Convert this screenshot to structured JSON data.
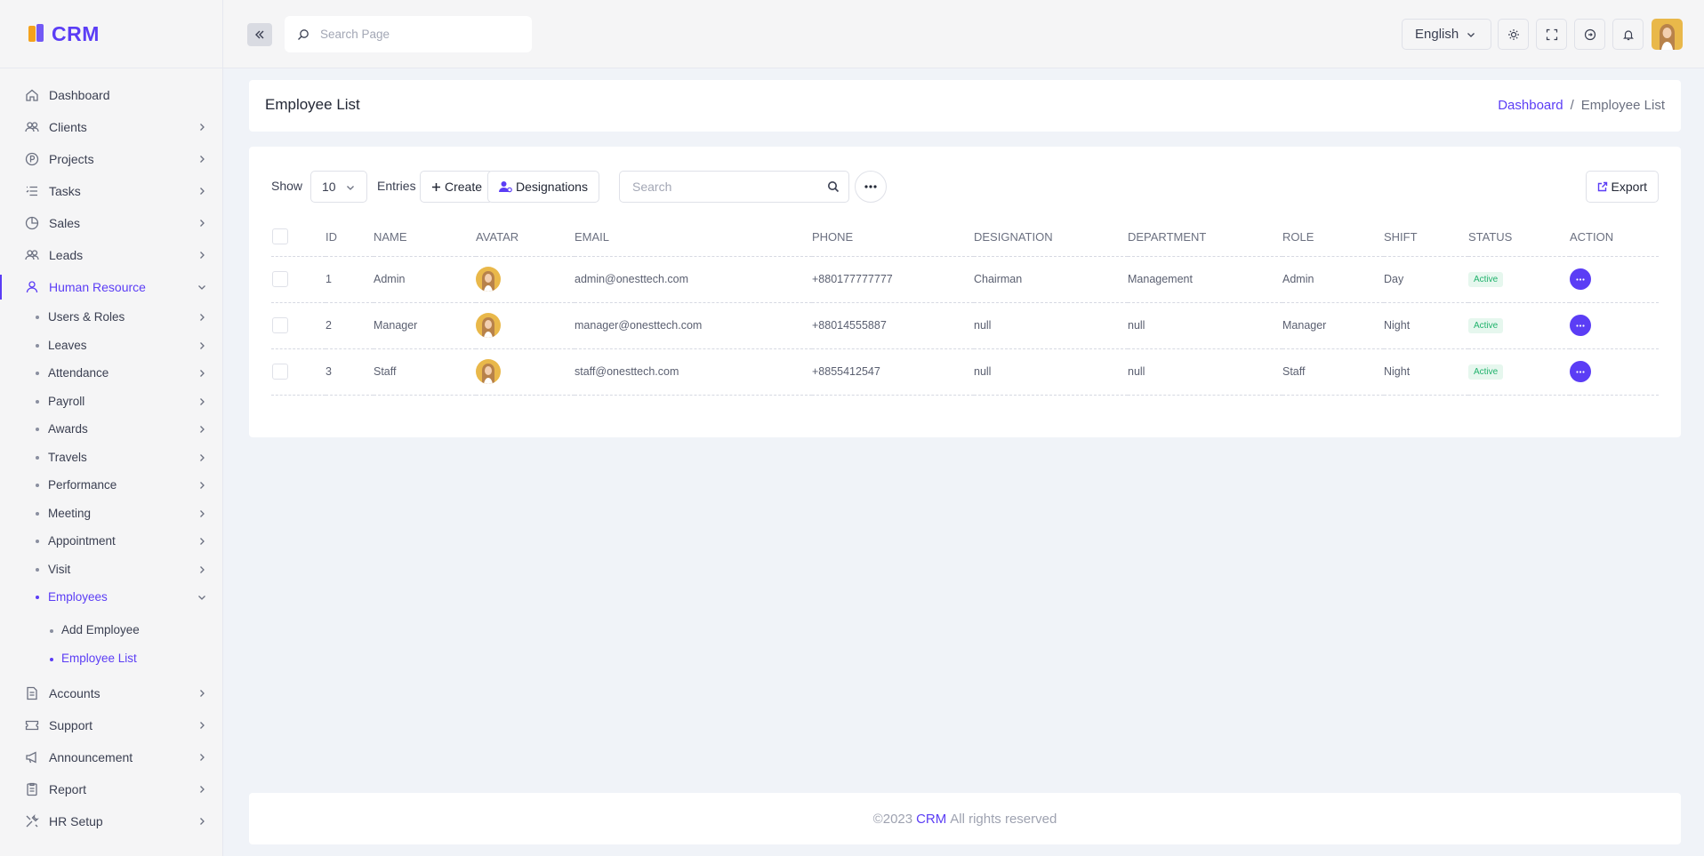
{
  "brand": {
    "name": "CRM"
  },
  "colors": {
    "accent": "#5b3df5",
    "status_active": "#20b26c"
  },
  "header": {
    "search_placeholder": "Search Page",
    "language": "English",
    "icons": [
      "sun-icon",
      "fullscreen-icon",
      "logout-icon",
      "bell-icon"
    ]
  },
  "sidebar": {
    "items": [
      {
        "label": "Dashboard",
        "icon": "home-icon"
      },
      {
        "label": "Clients",
        "icon": "users-icon"
      },
      {
        "label": "Projects",
        "icon": "project-icon"
      },
      {
        "label": "Tasks",
        "icon": "tasks-icon"
      },
      {
        "label": "Sales",
        "icon": "pie-icon"
      },
      {
        "label": "Leads",
        "icon": "users-icon"
      },
      {
        "label": "Human Resource",
        "icon": "user-icon"
      },
      {
        "label": "Accounts",
        "icon": "accounts-icon"
      },
      {
        "label": "Support",
        "icon": "ticket-icon"
      },
      {
        "label": "Announcement",
        "icon": "megaphone-icon"
      },
      {
        "label": "Report",
        "icon": "report-icon"
      },
      {
        "label": "HR Setup",
        "icon": "tools-icon"
      }
    ],
    "hr_sub": [
      "Users & Roles",
      "Leaves",
      "Attendance",
      "Payroll",
      "Awards",
      "Travels",
      "Performance",
      "Meeting",
      "Appointment",
      "Visit",
      "Employees"
    ],
    "employees_sub": [
      "Add Employee",
      "Employee List"
    ]
  },
  "page": {
    "title": "Employee List",
    "breadcrumb": {
      "home": "Dashboard",
      "sep": "/",
      "current": "Employee List"
    }
  },
  "toolbar": {
    "show_label": "Show",
    "entries_value": "10",
    "entries_label": "Entries",
    "create_label": "Create",
    "designations_label": "Designations",
    "search_placeholder": "Search",
    "export_label": "Export"
  },
  "table": {
    "columns": [
      "ID",
      "NAME",
      "AVATAR",
      "EMAIL",
      "PHONE",
      "DESIGNATION",
      "DEPARTMENT",
      "ROLE",
      "SHIFT",
      "STATUS",
      "ACTION"
    ],
    "rows": [
      {
        "id": "1",
        "name": "Admin",
        "email": "admin@onesttech.com",
        "phone": "+880177777777",
        "designation": "Chairman",
        "department": "Management",
        "role": "Admin",
        "shift": "Day",
        "status": "Active"
      },
      {
        "id": "2",
        "name": "Manager",
        "email": "manager@onesttech.com",
        "phone": "+88014555887",
        "designation": "null",
        "department": "null",
        "role": "Manager",
        "shift": "Night",
        "status": "Active"
      },
      {
        "id": "3",
        "name": "Staff",
        "email": "staff@onesttech.com",
        "phone": "+8855412547",
        "designation": "null",
        "department": "null",
        "role": "Staff",
        "shift": "Night",
        "status": "Active"
      }
    ]
  },
  "footer": {
    "prefix": "©2023",
    "brand": "CRM",
    "suffix": "All rights reserved"
  }
}
